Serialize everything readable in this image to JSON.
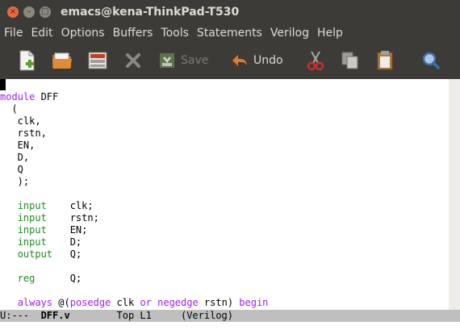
{
  "window": {
    "title": "emacs@kena-ThinkPad-T530",
    "close_glyph": "×",
    "minimize_glyph": "–",
    "maximize_glyph": "□"
  },
  "menu": [
    "File",
    "Edit",
    "Options",
    "Buffers",
    "Tools",
    "Statements",
    "Verilog",
    "Help"
  ],
  "toolbar": {
    "save_label": "Save",
    "undo_label": "Undo"
  },
  "icons": [
    "new-file-icon",
    "open-folder-icon",
    "dired-icon",
    "close-buffer-icon",
    "save-icon",
    "undo-icon",
    "cut-icon",
    "copy-icon",
    "paste-icon",
    "search-icon"
  ],
  "code_lines": [
    [],
    [
      {
        "t": "module",
        "c": "kw"
      },
      {
        "t": " DFF"
      }
    ],
    [
      {
        "t": "  ("
      }
    ],
    [
      {
        "t": "   clk,"
      }
    ],
    [
      {
        "t": "   rstn,"
      }
    ],
    [
      {
        "t": "   EN,"
      }
    ],
    [
      {
        "t": "   D,"
      }
    ],
    [
      {
        "t": "   Q"
      }
    ],
    [
      {
        "t": "   );"
      }
    ],
    [],
    [
      {
        "t": "   "
      },
      {
        "t": "input",
        "c": "ty"
      },
      {
        "t": "    clk;"
      }
    ],
    [
      {
        "t": "   "
      },
      {
        "t": "input",
        "c": "ty"
      },
      {
        "t": "    rstn;"
      }
    ],
    [
      {
        "t": "   "
      },
      {
        "t": "input",
        "c": "ty"
      },
      {
        "t": "    EN;"
      }
    ],
    [
      {
        "t": "   "
      },
      {
        "t": "input",
        "c": "ty"
      },
      {
        "t": "    D;"
      }
    ],
    [
      {
        "t": "   "
      },
      {
        "t": "output",
        "c": "ty"
      },
      {
        "t": "   Q;"
      }
    ],
    [],
    [
      {
        "t": "   "
      },
      {
        "t": "reg",
        "c": "ty"
      },
      {
        "t": "      Q;"
      }
    ],
    [],
    [
      {
        "t": "   "
      },
      {
        "t": "always",
        "c": "kw"
      },
      {
        "t": " @("
      },
      {
        "t": "posedge",
        "c": "kw"
      },
      {
        "t": " clk "
      },
      {
        "t": "or",
        "c": "kw"
      },
      {
        "t": " "
      },
      {
        "t": "negedge",
        "c": "kw"
      },
      {
        "t": " rstn) "
      },
      {
        "t": "begin",
        "c": "kw"
      }
    ]
  ],
  "modeline": {
    "status": "U:---  ",
    "buffer": "DFF.v",
    "position": "        Top L1     (Verilog)"
  },
  "colors": {
    "keyword": "#a020f0",
    "type": "#228b22",
    "chrome": "#3c3b37",
    "modeline": "#bfbfbf"
  }
}
